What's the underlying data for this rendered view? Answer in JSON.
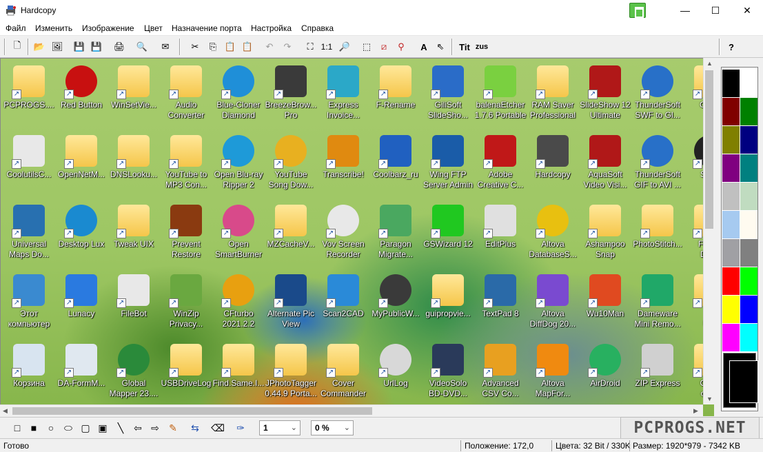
{
  "window": {
    "title": "Hardcopy",
    "minimize": "—",
    "maximize": "☐",
    "close": "✕"
  },
  "menu": [
    "Файл",
    "Изменить",
    "Изображение",
    "Цвет",
    "Назначение порта",
    "Настройка",
    "Справка"
  ],
  "toolbar": {
    "zoom_label": "1:1",
    "text_a": "A",
    "tit_label": "Tit",
    "zus_label": "zus",
    "help": "?"
  },
  "desktop_icons": [
    {
      "label": "PCPROGS....",
      "color": "#f0c84a",
      "kind": "folder"
    },
    {
      "label": "Red Button",
      "color": "#c81010",
      "kind": "round"
    },
    {
      "label": "WinSetVie...",
      "color": "#f0c84a",
      "kind": "folder"
    },
    {
      "label": "Audio\nConverter",
      "color": "#f0c84a",
      "kind": "folder"
    },
    {
      "label": "Blue-Cloner\nDiamond",
      "color": "#1f8fd8",
      "kind": "round"
    },
    {
      "label": "BreezeBrow...\nPro",
      "color": "#3a3a3a",
      "kind": "box"
    },
    {
      "label": "Express\nInvoice...",
      "color": "#2ba8c8",
      "kind": "box"
    },
    {
      "label": "F-Rename",
      "color": "#f0c84a",
      "kind": "folder"
    },
    {
      "label": "GiliSoft\nSlideSho...",
      "color": "#2a6cc8",
      "kind": "box"
    },
    {
      "label": "balenaEtcher\n1.7.6 Portable",
      "color": "#7ad040",
      "kind": "box"
    },
    {
      "label": "RAM Saver\nProfessional",
      "color": "#f0c84a",
      "kind": "folder"
    },
    {
      "label": "SlideShow 12\nUltimate",
      "color": "#b01818",
      "kind": "box"
    },
    {
      "label": "ThunderSoft\nSWF to Gl...",
      "color": "#2870c8",
      "kind": "round"
    },
    {
      "label": "Gram",
      "color": "#f0c84a",
      "kind": "folder"
    },
    {
      "label": "CoolutilsC...",
      "color": "#e8e8e8",
      "kind": "box"
    },
    {
      "label": "OpenNetM...",
      "color": "#f0c84a",
      "kind": "folder"
    },
    {
      "label": "DNSLooku...",
      "color": "#f0c84a",
      "kind": "folder"
    },
    {
      "label": "YouTube to\nMP3 Con...",
      "color": "#f0c84a",
      "kind": "folder"
    },
    {
      "label": "Open Blu-ray\nRipper 2",
      "color": "#1e9ad8",
      "kind": "round"
    },
    {
      "label": "YouTube\nSong Dow...",
      "color": "#e8b020",
      "kind": "round"
    },
    {
      "label": "Transcribe!",
      "color": "#e08a10",
      "kind": "box"
    },
    {
      "label": "Coolbarz_ru",
      "color": "#2060c0",
      "kind": "box"
    },
    {
      "label": "Wing FTP\nServer Admin",
      "color": "#1a5ca8",
      "kind": "box"
    },
    {
      "label": "Adobe\nCreative C...",
      "color": "#c01818",
      "kind": "box"
    },
    {
      "label": "Hardcopy",
      "color": "#4a4a4a",
      "kind": "box"
    },
    {
      "label": "AquaSoft\nVideo Visi...",
      "color": "#b01818",
      "kind": "box"
    },
    {
      "label": "ThunderSoft\nGIF to AVI ...",
      "color": "#2870c8",
      "kind": "round"
    },
    {
      "label": "Snap",
      "color": "#222222",
      "kind": "round"
    },
    {
      "label": "Universal\nMaps Do...",
      "color": "#2870b0",
      "kind": "box"
    },
    {
      "label": "Desktop Lux",
      "color": "#1a8ad0",
      "kind": "round"
    },
    {
      "label": "Tweak UIX",
      "color": "#f0c84a",
      "kind": "folder"
    },
    {
      "label": "Prevent\nRestore",
      "color": "#8a3a10",
      "kind": "box"
    },
    {
      "label": "Open\nSmartBurner",
      "color": "#d84a8a",
      "kind": "round"
    },
    {
      "label": "MZCacheV...",
      "color": "#f0c84a",
      "kind": "folder"
    },
    {
      "label": "Vov Screen\nRecorder",
      "color": "#e8e8e8",
      "kind": "round"
    },
    {
      "label": "Paragon\nMigrate...",
      "color": "#4aa860",
      "kind": "box"
    },
    {
      "label": "GSWizard 12",
      "color": "#20c820",
      "kind": "box"
    },
    {
      "label": "EditPlus",
      "color": "#e0e0e0",
      "kind": "box"
    },
    {
      "label": "Altova\nDatabaseS...",
      "color": "#e8c010",
      "kind": "round"
    },
    {
      "label": "Ashampoo\nSnap",
      "color": "#f0c84a",
      "kind": "folder"
    },
    {
      "label": "PhotoStitch...",
      "color": "#f0c84a",
      "kind": "folder"
    },
    {
      "label": "FreeG\nDonc",
      "color": "#f0c84a",
      "kind": "folder"
    },
    {
      "label": "Этот\nкомпьютер",
      "color": "#3a8ad0",
      "kind": "box"
    },
    {
      "label": "Lunacy",
      "color": "#2a7ae0",
      "kind": "box"
    },
    {
      "label": "FileBot",
      "color": "#e8e8e8",
      "kind": "box"
    },
    {
      "label": "WinZip\nPrivacy...",
      "color": "#6aa840",
      "kind": "box"
    },
    {
      "label": "CFturbo\n2021.2.2",
      "color": "#e8a010",
      "kind": "round"
    },
    {
      "label": "Alternate Pic\nView",
      "color": "#1a4a8a",
      "kind": "box"
    },
    {
      "label": "Scan2CAD",
      "color": "#2a8ad8",
      "kind": "box"
    },
    {
      "label": "MyPublicW...",
      "color": "#3a3a3a",
      "kind": "round"
    },
    {
      "label": "guipropvie...",
      "color": "#f0c84a",
      "kind": "folder"
    },
    {
      "label": "TextPad 8",
      "color": "#2a6aa8",
      "kind": "box"
    },
    {
      "label": "Altova\nDiffDog 20...",
      "color": "#7a4ad0",
      "kind": "box"
    },
    {
      "label": "Wu10Man",
      "color": "#e04a20",
      "kind": "box"
    },
    {
      "label": "Dameware\nMini Remo...",
      "color": "#20a868",
      "kind": "box"
    },
    {
      "label": "Tu\nUtili",
      "color": "#f0c84a",
      "kind": "folder"
    },
    {
      "label": "Корзина",
      "color": "#d8e4f0",
      "kind": "box"
    },
    {
      "label": "DA-FormM...",
      "color": "#e0e8f0",
      "kind": "box"
    },
    {
      "label": "Global\nMapper 23....",
      "color": "#2a8a3a",
      "kind": "round"
    },
    {
      "label": "USBDriveLog",
      "color": "#f0c84a",
      "kind": "folder"
    },
    {
      "label": "Find.Same.I...",
      "color": "#f0c84a",
      "kind": "folder"
    },
    {
      "label": "JPhotoTagger\n0.44.9 Porta...",
      "color": "#f0c84a",
      "kind": "folder"
    },
    {
      "label": "Cover\nCommander",
      "color": "#f0c84a",
      "kind": "folder"
    },
    {
      "label": "UrlLog",
      "color": "#d8d8d8",
      "kind": "round"
    },
    {
      "label": "VideoSolo\nBD-DVD...",
      "color": "#2a3a5a",
      "kind": "box"
    },
    {
      "label": "Advanced\nCSV Co...",
      "color": "#e8a020",
      "kind": "box"
    },
    {
      "label": "Altova\nMapFor...",
      "color": "#f08a10",
      "kind": "box"
    },
    {
      "label": "AirDroid",
      "color": "#28b060",
      "kind": "round"
    },
    {
      "label": "ZIP Express",
      "color": "#d0d0d0",
      "kind": "box"
    },
    {
      "label": "Обса\nодни",
      "color": "#f0c84a",
      "kind": "folder"
    }
  ],
  "palette": [
    "#000000",
    "#ffffff",
    "#800000",
    "#008000",
    "#808000",
    "#000080",
    "#800080",
    "#008080",
    "#c0c0c0",
    "#c0dcc0",
    "#a6caf0",
    "#fffbf0",
    "#a0a0a4",
    "#808080",
    "#ff0000",
    "#00ff00",
    "#ffff00",
    "#0000ff",
    "#ff00ff",
    "#00ffff"
  ],
  "drawbar": {
    "line_width": "1",
    "percent": "0 %"
  },
  "status": {
    "ready": "Готово",
    "position": "Положение: 172,0",
    "colors": "Цвета: 32 Bit / 330K",
    "size": "Размер: 1920*979  -  7342 KB"
  },
  "watermark": "PCPROGS.NET"
}
